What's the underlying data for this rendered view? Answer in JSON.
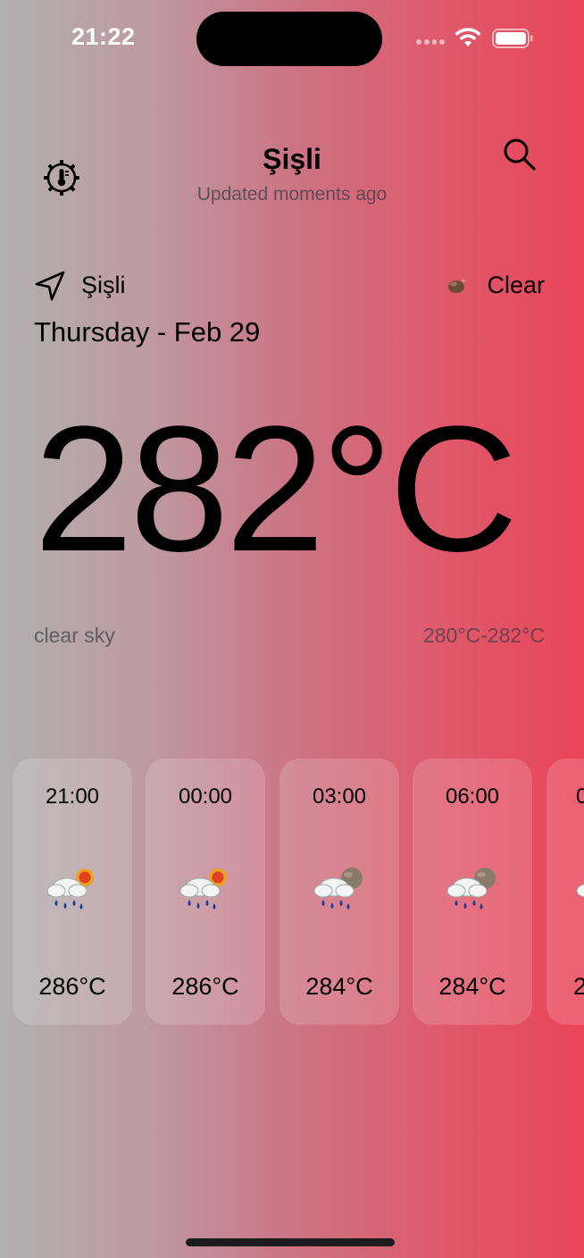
{
  "status_bar": {
    "time": "21:22"
  },
  "header": {
    "city": "Şişli",
    "updated": "Updated moments ago",
    "units_icon": "thermometer-gear-icon",
    "search_icon": "search-icon"
  },
  "location": {
    "name": "Şişli",
    "icon": "location-arrow-icon"
  },
  "condition": {
    "label": "Clear",
    "icon": "clear-night-icon"
  },
  "date": "Thursday - Feb 29",
  "current": {
    "temperature": "282°C",
    "description": "clear sky",
    "range": "280°C-282°C"
  },
  "forecast": [
    {
      "time": "21:00",
      "temp": "286°C",
      "icon": "rain-sun-cloud-icon"
    },
    {
      "time": "00:00",
      "temp": "286°C",
      "icon": "rain-sun-cloud-icon"
    },
    {
      "time": "03:00",
      "temp": "284°C",
      "icon": "rain-moon-cloud-icon"
    },
    {
      "time": "06:00",
      "temp": "284°C",
      "icon": "rain-moon-cloud-icon"
    },
    {
      "time": "0",
      "temp": "2",
      "icon": "rain-cloud-icon"
    }
  ]
}
